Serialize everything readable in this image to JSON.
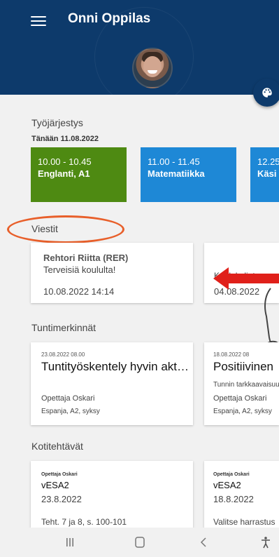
{
  "header": {
    "title": "Onni Oppilas",
    "menu_icon": "menu-icon",
    "fab_icon": "palette-icon"
  },
  "schedule": {
    "title": "Työjärjestys",
    "date": "Tänään 11.08.2022",
    "items": [
      {
        "time": "10.00 - 10.45",
        "subject": "Englanti, A1",
        "color": "#4e8a12"
      },
      {
        "time": "11.00 - 11.45",
        "subject": "Matematiikka",
        "color": "#1e88d6"
      },
      {
        "time": "12.25",
        "subject": "Käsi",
        "color": "#1e88d6"
      }
    ]
  },
  "messages": {
    "title": "Viestit",
    "items": [
      {
        "sender": "Rehtori Riitta (RER)",
        "subject": "Terveisiä koululta!",
        "time": "10.08.2022 14:14"
      },
      {
        "sender": "",
        "subject": "Koulukuljetus",
        "time": "04.08.2022"
      }
    ]
  },
  "entries": {
    "title": "Tuntimerkinnät",
    "items": [
      {
        "datetime": "23.08.2022 08.00",
        "title": "Tuntityöskentely hyvin akt…",
        "subtitle": "",
        "teacher": "Opettaja Oskari",
        "course": "Espanja, A2, syksy"
      },
      {
        "datetime": "18.08.2022 08",
        "title": "Positiivinen",
        "subtitle": "Tunnin tarkkaavaisuus",
        "teacher": "Opettaja Oskari",
        "course": "Espanja, A2, syksy"
      }
    ]
  },
  "homework": {
    "title": "Kotitehtävät",
    "items": [
      {
        "teacher": "Opettaja Oskari",
        "title": "vESA2",
        "date": "23.8.2022",
        "description": "Teht. 7 ja 8, s. 100-101"
      },
      {
        "teacher": "Opettaja Oskari",
        "title": "vESA2",
        "date": "18.8.2022",
        "description": "Valitse harrastus"
      }
    ]
  },
  "annotations": {
    "oval_color": "#e85f2a",
    "arrow_color": "#e0201a"
  },
  "navbar": {
    "recent_icon": "recent-apps-icon",
    "home_icon": "home-icon",
    "back_icon": "back-icon",
    "a11y_icon": "accessibility-icon"
  }
}
